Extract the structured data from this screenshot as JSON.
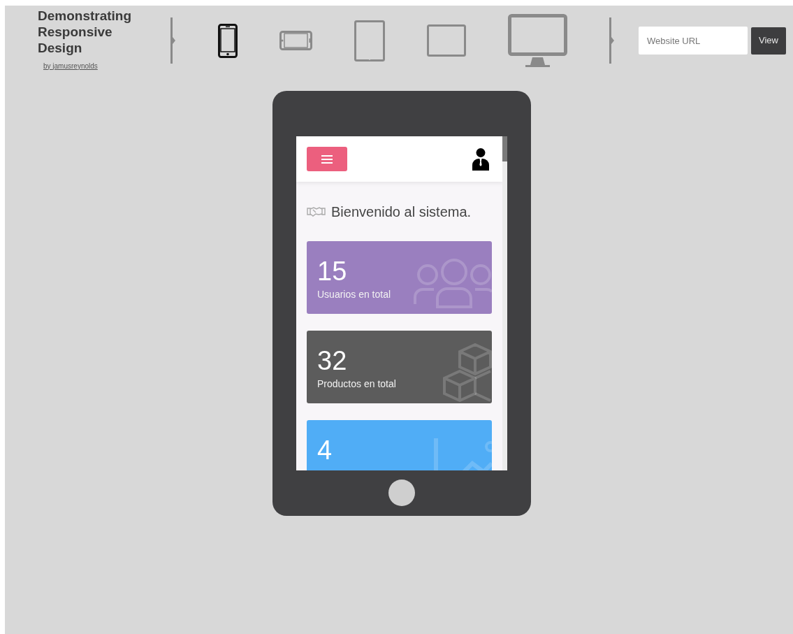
{
  "header": {
    "title": "Demonstrating Responsive Design",
    "byline": "by jamusreynolds"
  },
  "devices": [
    {
      "kind": "phone",
      "selected": true
    },
    {
      "kind": "phone-landscape",
      "selected": false
    },
    {
      "kind": "tablet",
      "selected": false
    },
    {
      "kind": "tablet-landscape",
      "selected": false
    },
    {
      "kind": "desktop",
      "selected": false
    }
  ],
  "url_bar": {
    "placeholder": "Website URL",
    "button": "View"
  },
  "preview": {
    "welcome": "Bienvenido al sistema.",
    "cards": [
      {
        "value": "15",
        "label": "Usuarios en total",
        "color": "#9a7fbf",
        "kind": "users"
      },
      {
        "value": "32",
        "label": "Productos en total",
        "color": "#5c5c5c",
        "kind": "boxes"
      },
      {
        "value": "4",
        "color": "#50adf6",
        "kind": "chart"
      }
    ]
  }
}
